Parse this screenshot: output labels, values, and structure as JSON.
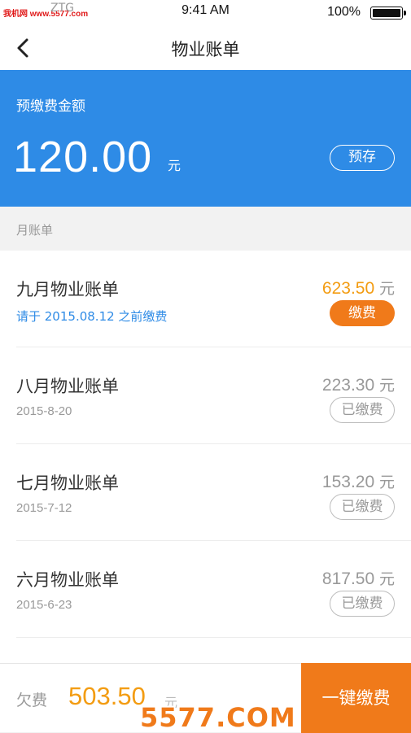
{
  "status_bar": {
    "watermark": "我机网 www.5577.com",
    "carrier": "ZTG",
    "time": "9:41 AM",
    "battery": "100%"
  },
  "nav": {
    "title": "物业账单"
  },
  "header": {
    "label": "预缴费金额",
    "amount": "120.00",
    "unit": "元",
    "prepay_button": "预存",
    "background": "#2e8be6"
  },
  "section_title": "月账单",
  "bills": [
    {
      "name": "九月物业账单",
      "sub": "请于 2015.08.12 之前缴费",
      "amount": "623.50",
      "unit": "元",
      "action": "缴费",
      "status": "due"
    },
    {
      "name": "八月物业账单",
      "sub": "2015-8-20",
      "amount": "223.30",
      "unit": "元",
      "action": "已缴费",
      "status": "paid"
    },
    {
      "name": "七月物业账单",
      "sub": "2015-7-12",
      "amount": "153.20",
      "unit": "元",
      "action": "已缴费",
      "status": "paid"
    },
    {
      "name": "六月物业账单",
      "sub": "2015-6-23",
      "amount": "817.50",
      "unit": "元",
      "action": "已缴费",
      "status": "paid"
    }
  ],
  "footer": {
    "owed_label": "欠费",
    "owed_amount": "503.50",
    "owed_unit": "元",
    "pay_all_button": "一键缴费",
    "watermark": "5577.COM"
  },
  "colors": {
    "accent_blue": "#2e8be6",
    "accent_orange": "#f07a1a",
    "amount_orange": "#f39c12"
  }
}
